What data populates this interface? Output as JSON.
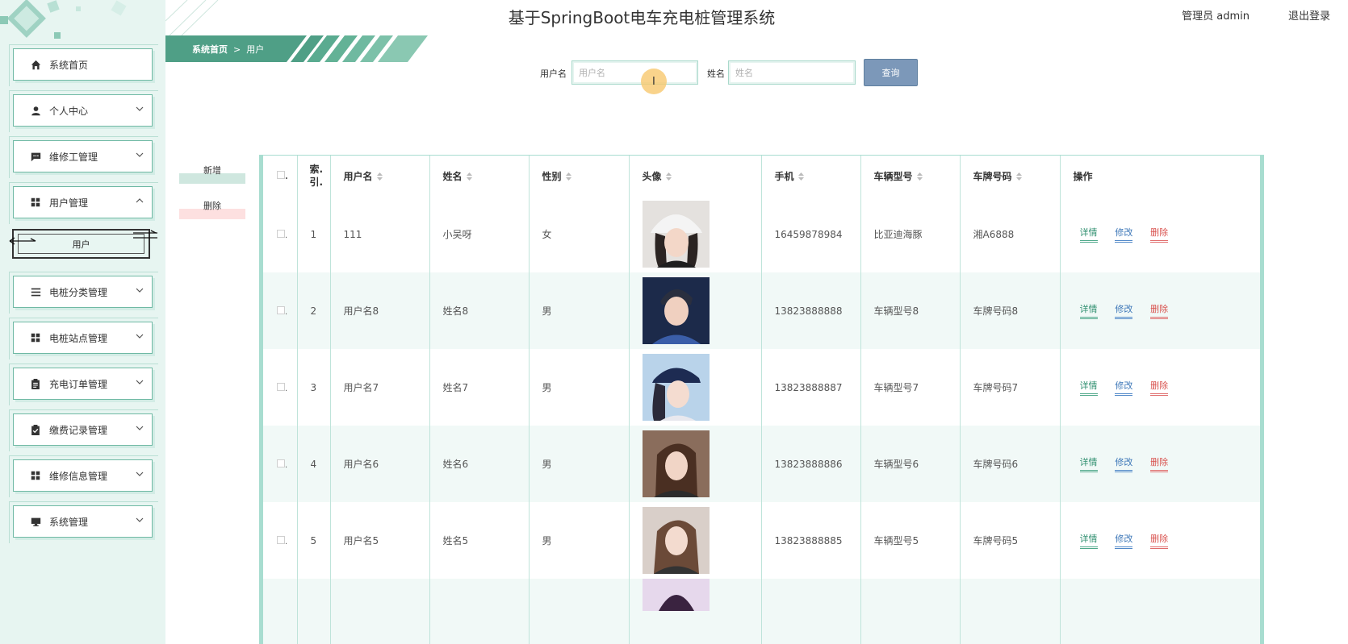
{
  "header": {
    "title": "基于SpringBoot电车充电桩管理系统",
    "user": "管理员 admin",
    "logout": "退出登录"
  },
  "breadcrumb": {
    "home": "系统首页",
    "separator": ">",
    "current": "用户"
  },
  "sidebar": {
    "items": [
      {
        "label": "系统首页",
        "icon": "home-icon",
        "chevron": false
      },
      {
        "label": "个人中心",
        "icon": "person-icon",
        "chevron": true
      },
      {
        "label": "维修工管理",
        "icon": "message-icon",
        "chevron": true
      },
      {
        "label": "用户管理",
        "icon": "grid-icon",
        "chevron": true,
        "expanded": true
      },
      {
        "label": "电桩分类管理",
        "icon": "list-icon",
        "chevron": true
      },
      {
        "label": "电桩站点管理",
        "icon": "grid-icon",
        "chevron": true
      },
      {
        "label": "充电订单管理",
        "icon": "clipboard-icon",
        "chevron": true
      },
      {
        "label": "缴费记录管理",
        "icon": "clipboard-check-icon",
        "chevron": true
      },
      {
        "label": "维修信息管理",
        "icon": "grid-icon",
        "chevron": true
      },
      {
        "label": "系统管理",
        "icon": "monitor-icon",
        "chevron": true
      }
    ],
    "sub_item": "用户"
  },
  "search": {
    "username_label": "用户名",
    "username_placeholder": "用户名",
    "name_label": "姓名",
    "name_placeholder": "姓名",
    "button": "查询"
  },
  "actions": {
    "add": "新增",
    "delete": "删除"
  },
  "table": {
    "columns": [
      "索.\n引.",
      "用户名",
      "姓名",
      "性别",
      "头像",
      "手机",
      "车辆型号",
      "车牌号码",
      "操作"
    ],
    "index_header_top": "索.",
    "index_header_bottom": "引.",
    "col_username": "用户名",
    "col_name": "姓名",
    "col_gender": "性别",
    "col_avatar": "头像",
    "col_phone": "手机",
    "col_car_model": "车辆型号",
    "col_plate": "车牌号码",
    "col_ops": "操作",
    "rows": [
      {
        "index": "1",
        "username": "111",
        "name": "小吴呀",
        "gender": "女",
        "phone": "16459878984",
        "car_model": "比亚迪海豚",
        "plate": "湘A6888"
      },
      {
        "index": "2",
        "username": "用户名8",
        "name": "姓名8",
        "gender": "男",
        "phone": "13823888888",
        "car_model": "车辆型号8",
        "plate": "车牌号码8"
      },
      {
        "index": "3",
        "username": "用户名7",
        "name": "姓名7",
        "gender": "男",
        "phone": "13823888887",
        "car_model": "车辆型号7",
        "plate": "车牌号码7"
      },
      {
        "index": "4",
        "username": "用户名6",
        "name": "姓名6",
        "gender": "男",
        "phone": "13823888886",
        "car_model": "车辆型号6",
        "plate": "车牌号码6"
      },
      {
        "index": "5",
        "username": "用户名5",
        "name": "姓名5",
        "gender": "男",
        "phone": "13823888885",
        "car_model": "车辆型号5",
        "plate": "车牌号码5"
      }
    ],
    "ops": {
      "detail": "详情",
      "edit": "修改",
      "delete": "删除"
    }
  },
  "colors": {
    "accent": "#4fa88a",
    "sidebar_bg": "#e7f5f1",
    "search_button": "#7c98b9",
    "delete_red": "#d9534f",
    "edit_blue": "#3d77b8"
  }
}
